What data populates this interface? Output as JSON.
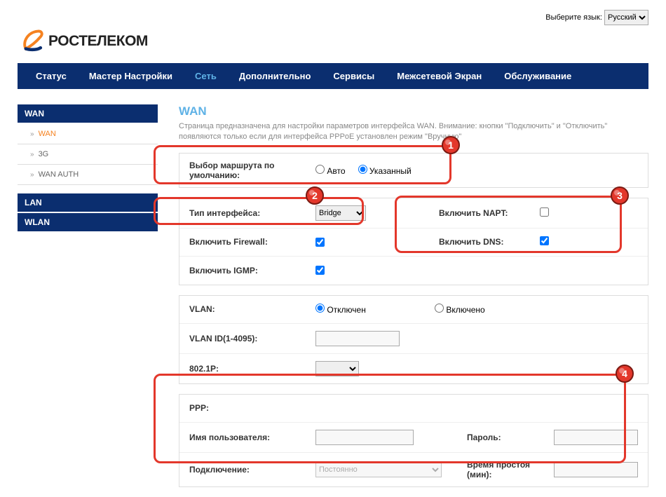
{
  "lang": {
    "label": "Выберите язык:",
    "value": "Русский"
  },
  "brand": "РОСТЕЛЕКОМ",
  "nav": [
    {
      "label": "Статус"
    },
    {
      "label": "Мастер Настройки"
    },
    {
      "label": "Сеть",
      "active": true
    },
    {
      "label": "Дополнительно"
    },
    {
      "label": "Сервисы"
    },
    {
      "label": "Межсетевой Экран"
    },
    {
      "label": "Обслуживание"
    }
  ],
  "sidebar": {
    "groups": [
      {
        "head": "WAN",
        "items": [
          {
            "label": "WAN",
            "active": true
          },
          {
            "label": "3G"
          },
          {
            "label": "WAN AUTH"
          }
        ]
      },
      {
        "head": "LAN",
        "items": []
      },
      {
        "head": "WLAN",
        "items": []
      }
    ]
  },
  "page": {
    "title": "WAN",
    "desc": "Страница предназначена для настройки параметров интерфейса WAN. Внимание: кнопки \"Подключить\" и \"Отключить\" появляются только если для интерфейса PPPoE установлен режим \"Вручную\""
  },
  "form": {
    "route_label": "Выбор маршрута по умолчанию:",
    "route_auto": "Авто",
    "route_specified": "Указанный",
    "iface_type_label": "Тип интерфейса:",
    "iface_type_value": "Bridge",
    "napt_label": "Включить NAPT:",
    "firewall_label": "Включить Firewall:",
    "dns_label": "Включить DNS:",
    "igmp_label": "Включить IGMP:",
    "vlan_label": "VLAN:",
    "vlan_off": "Отключен",
    "vlan_on": "Включено",
    "vlan_id_label": "VLAN ID(1-4095):",
    "p8021_label": "802.1P:",
    "ppp_label": "PPP:",
    "user_label": "Имя пользователя:",
    "pass_label": "Пароль:",
    "conn_label": "Подключение:",
    "conn_value": "Постоянно",
    "idle_label": "Время простоя (мин):"
  },
  "badges": {
    "b1": "1",
    "b2": "2",
    "b3": "3",
    "b4": "4"
  }
}
